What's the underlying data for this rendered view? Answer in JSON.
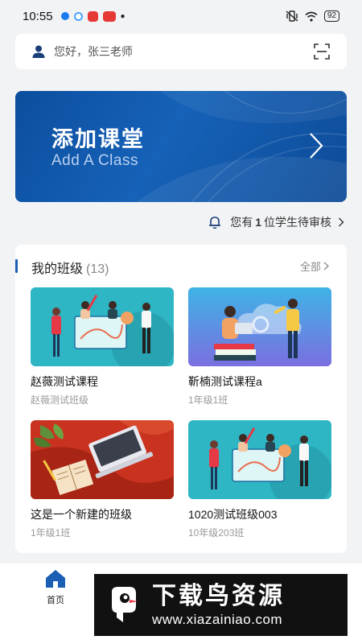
{
  "status_bar": {
    "time": "10:55",
    "battery": "92",
    "app_icons": [
      "#1a7cf0",
      "#4aa3ff",
      "#e53935",
      "#e53935"
    ]
  },
  "header": {
    "greeting": "您好，张三老师",
    "user_icon": "user-icon",
    "scan_icon": "scan-icon"
  },
  "banner": {
    "title": "添加课堂",
    "subtitle": "Add A Class",
    "arrow_icon": "chevron-right-icon"
  },
  "notice": {
    "prefix": "您有",
    "count": "1",
    "suffix": "位学生待审核"
  },
  "classes": {
    "title": "我的班级",
    "count": "(13)",
    "all_label": "全部",
    "items": [
      {
        "name": "赵薇测试课程",
        "grade": "赵薇测试班级",
        "image": "team-presentation-illustration"
      },
      {
        "name": "靳楠测试课程a",
        "grade": "1年级1班",
        "image": "teacher-books-illustration"
      },
      {
        "name": "这是一个新建的班级",
        "grade": "1年级1班",
        "image": "laptop-desk-illustration"
      },
      {
        "name": "1020测试班级003",
        "grade": "10年级203班",
        "image": "team-presentation-illustration"
      }
    ]
  },
  "tab_bar": {
    "home_label": "首页"
  },
  "watermark": {
    "title": "下载鸟资源",
    "url": "www.xiazainiao.com"
  },
  "colors": {
    "accent": "#1a5fb4",
    "banner": "#0c4e9e",
    "background": "#f2f3f5"
  }
}
